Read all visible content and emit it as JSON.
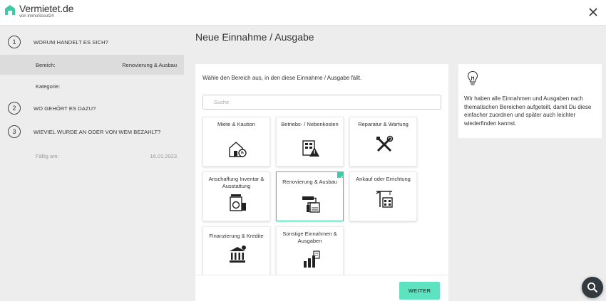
{
  "app": {
    "brand": "Vermietet.de",
    "brand_sub": "von ImmoScout24"
  },
  "main": {
    "title": "Neue Einnahme / Ausgabe",
    "intro": "Wähle den Bereich aus, in den diese Einnahme / Ausgabe fällt.",
    "search_placeholder": "Suche",
    "tiles": [
      {
        "label": "Miete & Kaution",
        "icon": "house-icon",
        "selected": false
      },
      {
        "label": "Betriebs- / Nebenkosten",
        "icon": "utility-meter-icon",
        "selected": false
      },
      {
        "label": "Reparatur & Wartung",
        "icon": "tools-icon",
        "selected": false
      },
      {
        "label": "Anschaffung Inventar & Ausstattung",
        "icon": "appliance-icon",
        "selected": false
      },
      {
        "label": "Renovierung & Ausbau",
        "icon": "paint-roller-icon",
        "selected": true
      },
      {
        "label": "Ankauf oder Errichtung",
        "icon": "crane-building-icon",
        "selected": false
      },
      {
        "label": "Finanzierung & Kredite",
        "icon": "bank-icon",
        "selected": false
      },
      {
        "label": "Sonstige Einnahmen & Ausgaben",
        "icon": "chart-icon",
        "selected": false
      }
    ],
    "continue_label": "WEITER"
  },
  "sidebar": {
    "steps": [
      {
        "num": "1",
        "label": "WORUM HANDELT ES SICH?"
      },
      {
        "num": "2",
        "label": "WO GEHÖRT ES DAZU?"
      },
      {
        "num": "3",
        "label": "WIEVIEL WURDE AN ODER VON WEM BEZAHLT?"
      }
    ],
    "bereich_key": "Bereich:",
    "bereich_value": "Renovierung & Ausbau",
    "kategorie_key": "Kategorie:",
    "faellig_key": "Fällig am:",
    "faellig_value": "16.01.2023"
  },
  "hint": {
    "text": "Wir haben alle Einnahmen und Ausgaben nach thematischen Bereichen aufgeteilt, damit Du diese einfacher zuordnen und später auch leichter wiederfinden kannst."
  },
  "colors": {
    "accent": "#3ec9a7",
    "button": "#5ee3c0",
    "sidebar_active": "#dcdcdc"
  }
}
